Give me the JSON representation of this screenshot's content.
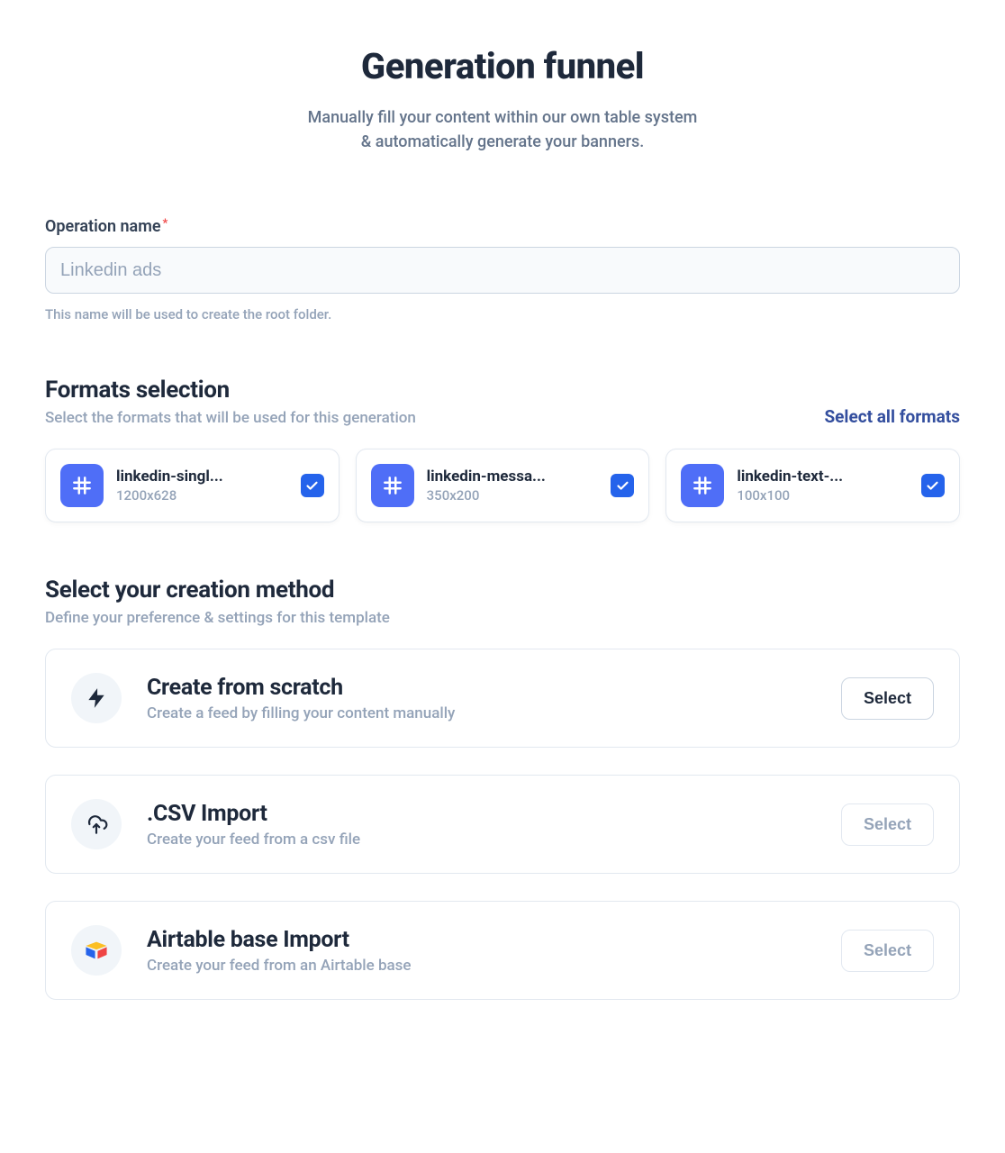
{
  "header": {
    "title": "Generation funnel",
    "subtitle_line1": "Manually fill your content within our own table system",
    "subtitle_line2": "& automatically generate your banners."
  },
  "operation": {
    "label": "Operation name",
    "value": "Linkedin ads",
    "help": "This name will be used to create the root folder."
  },
  "formats": {
    "title": "Formats selection",
    "description": "Select the formats that will be used for this generation",
    "select_all_label": "Select all formats",
    "items": [
      {
        "name": "linkedin-singl...",
        "dimensions": "1200x628",
        "checked": true
      },
      {
        "name": "linkedin-messa...",
        "dimensions": "350x200",
        "checked": true
      },
      {
        "name": "linkedin-text-...",
        "dimensions": "100x100",
        "checked": true
      }
    ]
  },
  "methods": {
    "title": "Select your creation method",
    "description": "Define your preference & settings for this template",
    "items": [
      {
        "icon": "bolt",
        "title": "Create from scratch",
        "description": "Create a feed by filling your content manually",
        "button_label": "Select",
        "enabled": true
      },
      {
        "icon": "cloud-upload",
        "title": ".CSV Import",
        "description": "Create your feed from a csv file",
        "button_label": "Select",
        "enabled": false
      },
      {
        "icon": "airtable",
        "title": "Airtable base Import",
        "description": "Create your feed from an Airtable base",
        "button_label": "Select",
        "enabled": false
      }
    ]
  }
}
